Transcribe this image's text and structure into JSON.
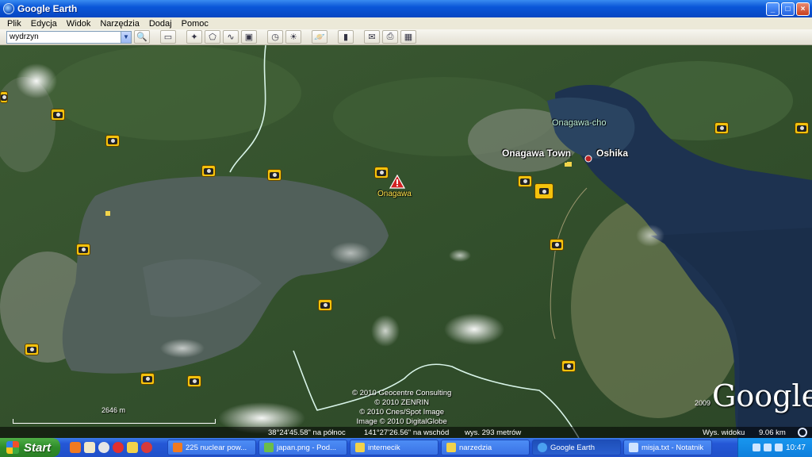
{
  "window": {
    "title": "Google Earth",
    "minimize": "_",
    "maximize": "□",
    "close": "×"
  },
  "menu": [
    "Plik",
    "Edycja",
    "Widok",
    "Narzędzia",
    "Dodaj",
    "Pomoc"
  ],
  "search": {
    "value": "wydrzyn"
  },
  "map": {
    "labels": {
      "onagawa_cho": "Onagawa-cho",
      "onagawa_town": "Onagawa Town",
      "oshika": "Oshika",
      "onagawa": "Onagawa"
    },
    "copyright": [
      "© 2010 Geocentre Consulting",
      "© 2010 ZENRIN",
      "© 2010 Cnes/Spot Image",
      "Image © 2010 DigitalGlobe"
    ],
    "logo": "Google",
    "year": "2009",
    "scale_label": "2646 m",
    "status": {
      "lat": "38°24'45.58\" na północ",
      "lon": "141°27'26.56\" na wschód",
      "elev": "wys.   293 metrów",
      "eye": "Wys. widoku",
      "eye_value": "9.06 km"
    }
  },
  "taskbar": {
    "start": "Start",
    "tasks": [
      {
        "label": "225 nuclear pow...",
        "color": "#f07a20"
      },
      {
        "label": "japan.png - Pod...",
        "color": "#6bbd4a"
      },
      {
        "label": "internecik",
        "color": "#f2d24a"
      },
      {
        "label": "narzedzia",
        "color": "#f2d24a"
      },
      {
        "label": "Google Earth",
        "color": "#4aa0f0"
      },
      {
        "label": "misja.txt - Notatnik",
        "color": "#cfe3ff"
      }
    ],
    "clock": "10:47"
  }
}
